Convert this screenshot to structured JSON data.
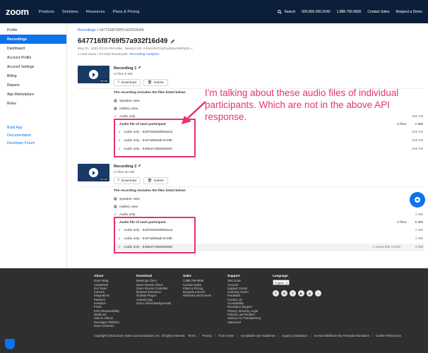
{
  "header": {
    "logo": "zoom",
    "nav": [
      "Products",
      "Solutions",
      "Resources",
      "Plans & Pricing"
    ],
    "search": "Search",
    "phone1": "000.800.050.2040",
    "phone2": "1.888.799.9666",
    "contact_sales": "Contact Sales",
    "request_demo": "Request a Demo"
  },
  "sidebar": {
    "items": [
      "Profile",
      "Recordings",
      "Dashboard",
      "Account Profile",
      "Account Settings",
      "Billing",
      "Reports",
      "App Marketplace",
      "Roles"
    ],
    "active": "Recordings",
    "links": [
      "Build App",
      "Documentation",
      "Developer Forum"
    ]
  },
  "main": {
    "breadcrumb_root": "Recordings",
    "breadcrumb_sep": ">",
    "breadcrumb_current": "647716f8769f57a932f16d49",
    "title": "647716f8769f57a932f16d49",
    "meta_date": "May 31, 2023 03:20 PM India",
    "meta_session": "Session ID: AIfo4A3N7GpOvvb8yAM0FpQ==",
    "meta_totals": "4 total views • 24 total downloads",
    "meta_link": "Recording Analytics",
    "includes_label": "The recording includes the files listed below:"
  },
  "recordings": [
    {
      "name": "Recording 1",
      "sub": "6 Files  9 MB",
      "duration": "00:38",
      "download": "Download",
      "delete": "Delete",
      "files": [
        {
          "name": "Speaker view",
          "size": ""
        },
        {
          "name": "Gallery view",
          "size": ""
        },
        {
          "name": "Audio only",
          "size": "580 KB"
        }
      ],
      "group": {
        "name": "Audio file of each participant",
        "count": "3 files",
        "size": "2 MB"
      },
      "participants": [
        {
          "name": "Audio only - 63d763a9dd99a51a",
          "size": "559 KB"
        },
        {
          "name": "Audio only - 6447a559adc4c48b",
          "size": "559 KB"
        },
        {
          "name": "Audio only - 6465a7c550653602",
          "size": "559 KB"
        }
      ]
    },
    {
      "name": "Recording 2",
      "sub": "6 Files  20 MB",
      "duration": "01:42",
      "download": "Download",
      "delete": "Delete",
      "files": [
        {
          "name": "Speaker view",
          "size": ""
        },
        {
          "name": "Gallery view",
          "size": ""
        },
        {
          "name": "Audio only",
          "size": "2 MB"
        }
      ],
      "group": {
        "name": "Audio file of each participant",
        "count": "3 files",
        "size": "5 MB"
      },
      "participants": [
        {
          "name": "Audio only - 63d763a9dd99a51a",
          "size": "2 MB"
        },
        {
          "name": "Audio only - 6447a559adc4c48b",
          "size": "2 MB"
        },
        {
          "name": "Audio only - 6465a7c550653602",
          "size": "2 MB",
          "views": "1 views this month"
        }
      ]
    }
  ],
  "annotation": "I'm talking about these audio files of individual participants. Which are not in the above API response.",
  "footer": {
    "about": {
      "title": "About",
      "items": [
        "Zoom Blog",
        "Customers",
        "Our Team",
        "Careers",
        "Integrations",
        "Partners",
        "Investors",
        "Press",
        "ESG Responsibility",
        "Media Kit",
        "How to Videos",
        "Developer Platform",
        "Zoom Ventures"
      ]
    },
    "download": {
      "title": "Download",
      "items": [
        "Meetings Client",
        "Zoom Rooms Client",
        "Zoom Rooms Controller",
        "Browser Extension",
        "Outlook Plug-in",
        "Android App",
        "Zoom Virtual Backgrounds"
      ]
    },
    "sales": {
      "title": "Sales",
      "items": [
        "1.888.799.9666",
        "Contact Sales",
        "Plans & Pricing",
        "Request a Demo",
        "Webinars and Events"
      ]
    },
    "support": {
      "title": "Support",
      "items": [
        "Test Zoom",
        "Account",
        "Support Center",
        "Learning Center",
        "Feedback",
        "Contact Us",
        "Accessibility",
        "Developer Support",
        "Privacy, Security, Legal Policies, and Modern",
        "Slavery Act Transparency",
        "Statement"
      ]
    },
    "language": {
      "title": "Language",
      "selected": "English"
    },
    "copyright": "Copyright ©2023 Zoom Video Communications, Inc. All rights reserved.",
    "legal_links": [
      "Terms",
      "Privacy",
      "Trust Center",
      "Acceptable Use Guidelines",
      "Legal & Compliance",
      "Do Not Sell/Share My Personal Information",
      "Cookie Preferences"
    ]
  },
  "colors": {
    "brand": "#0e72ed",
    "nav_bg": "#0b1f3a",
    "highlight": "#e8336b",
    "footer_bg": "#2f2f2f"
  }
}
